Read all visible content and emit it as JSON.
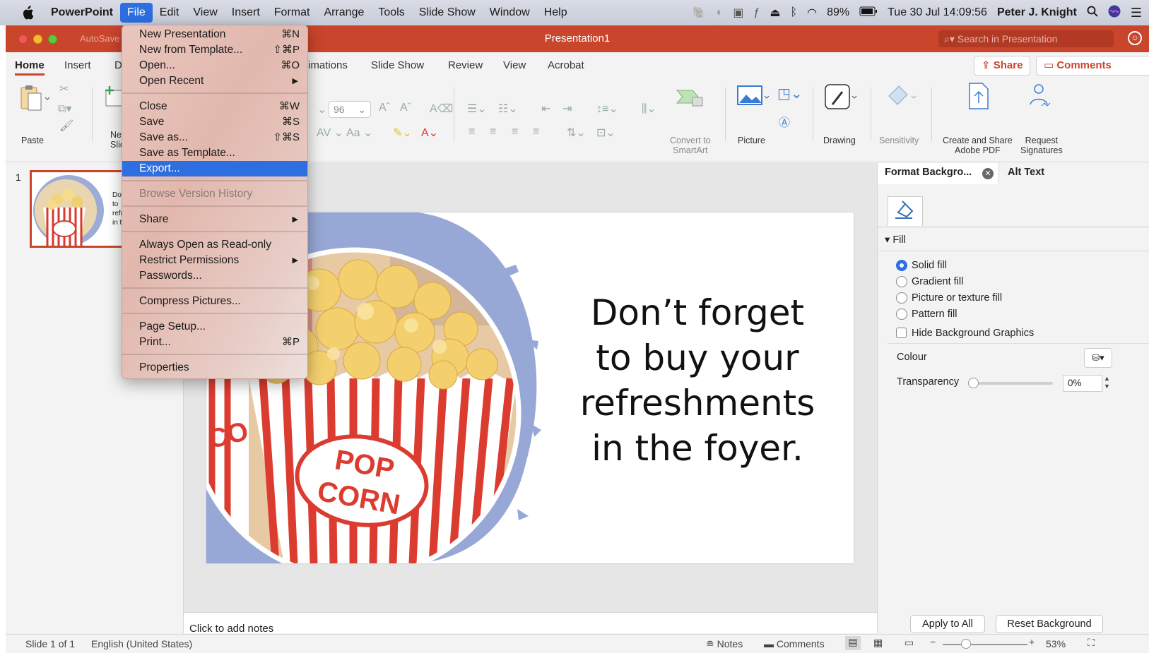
{
  "menubar": {
    "apple": "",
    "app": "PowerPoint",
    "items": [
      "File",
      "Edit",
      "View",
      "Insert",
      "Format",
      "Arrange",
      "Tools",
      "Slide Show",
      "Window",
      "Help"
    ],
    "battery": "89%",
    "datetime": "Tue 30 Jul  14:09:56",
    "user": "Peter J. Knight"
  },
  "window": {
    "autosave": "AutoSave",
    "title": "Presentation1",
    "search_placeholder": "Search in Presentation"
  },
  "tabs": [
    "Home",
    "Insert",
    "D",
    "imations",
    "Slide Show",
    "Review",
    "View",
    "Acrobat"
  ],
  "share_label": "Share",
  "comments_label": "Comments",
  "ribbon": {
    "paste": "Paste",
    "new_slide_1": "Ne",
    "new_slide_2": "Slic",
    "font_size": "96",
    "convert_1": "Convert to",
    "convert_2": "SmartArt",
    "picture": "Picture",
    "drawing": "Drawing",
    "sensitivity": "Sensitivity",
    "create_pdf_1": "Create and Share",
    "create_pdf_2": "Adobe PDF",
    "request_1": "Request",
    "request_2": "Signatures"
  },
  "file_menu": {
    "items": [
      {
        "label": "New Presentation",
        "shortcut": "⌘N"
      },
      {
        "label": "New from Template...",
        "shortcut": "⇧⌘P"
      },
      {
        "label": "Open...",
        "shortcut": "⌘O"
      },
      {
        "label": "Open Recent",
        "submenu": true
      },
      {
        "label": "Close",
        "shortcut": "⌘W"
      },
      {
        "label": "Save",
        "shortcut": "⌘S"
      },
      {
        "label": "Save as...",
        "shortcut": "⇧⌘S"
      },
      {
        "label": "Save as Template..."
      },
      {
        "label": "Export...",
        "highlighted": true
      },
      {
        "label": "Browse Version History",
        "disabled": true
      },
      {
        "label": "Share",
        "submenu": true
      },
      {
        "label": "Always Open as Read-only"
      },
      {
        "label": "Restrict Permissions",
        "submenu": true
      },
      {
        "label": "Passwords..."
      },
      {
        "label": "Compress Pictures..."
      },
      {
        "label": "Page Setup..."
      },
      {
        "label": "Print...",
        "shortcut": "⌘P"
      },
      {
        "label": "Properties"
      }
    ]
  },
  "thumbnail": {
    "number": "1",
    "snippet": [
      "Do",
      "to",
      "refr",
      "in t"
    ]
  },
  "slide": {
    "lines": [
      "Don’t forget",
      "to buy your",
      "refreshments",
      "in the foyer."
    ],
    "box_text_1": "POP",
    "box_text_2": "CORN",
    "box_side_text": "CO"
  },
  "notes_placeholder": "Click to add notes",
  "format_pane": {
    "tab_active": "Format Backgro...",
    "tab_other": "Alt Text",
    "section": "Fill",
    "fill_options": [
      "Solid fill",
      "Gradient fill",
      "Picture or texture fill",
      "Pattern fill"
    ],
    "selected_fill": "Solid fill",
    "hide_bg": "Hide Background Graphics",
    "colour": "Colour",
    "transparency": "Transparency",
    "transparency_value": "0%",
    "transparency_level": 0,
    "apply_all": "Apply to All",
    "reset": "Reset Background"
  },
  "status": {
    "slide": "Slide 1 of 1",
    "language": "English (United States)",
    "notes": "Notes",
    "comments": "Comments",
    "zoom": "53%"
  },
  "colors": {
    "title_bar": "#c9452c",
    "menu_highlight": "#2d6ee0"
  }
}
